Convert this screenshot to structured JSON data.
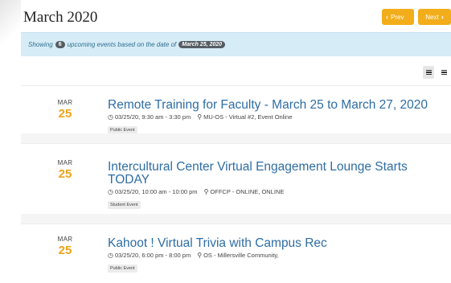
{
  "header": {
    "month_title": "March 2020",
    "prev_label": "Prev",
    "next_label": "Next"
  },
  "info_bar": {
    "showing": "Showing",
    "count": "6",
    "mid_text": "upcoming events based on the date of",
    "date_pill": "March 25, 2020"
  },
  "view_toggles": [
    "grid-view",
    "list-view"
  ],
  "events": [
    {
      "month": "MAR",
      "day": "25",
      "title": "Remote Training for Faculty - March 25 to March 27, 2020",
      "time": "03/25/20, 9:30 am - 3:30 pm",
      "location": "MU-OS - Virtual #2, Event Online",
      "tag": "Public Event"
    },
    {
      "month": "MAR",
      "day": "25",
      "title": "Intercultural Center Virtual Engagement Lounge Starts TODAY",
      "time": "03/25/20, 10:00 am - 10:00 pm",
      "location": "OFFCP - ONLINE, ONLINE",
      "tag": "Student Event"
    },
    {
      "month": "MAR",
      "day": "25",
      "title": "Kahoot ! Virtual Trivia with Campus Rec",
      "time": "03/25/20, 6:00 pm - 8:00 pm",
      "location": "OS - Millersville Community,",
      "tag": "Public Event"
    }
  ],
  "colors": {
    "accent": "#f2ad1a",
    "title_link": "#2e6da4",
    "info_bg": "#d6ecf7"
  }
}
